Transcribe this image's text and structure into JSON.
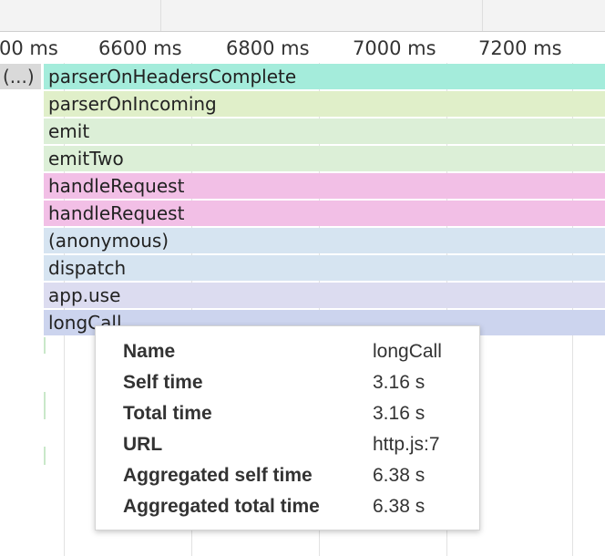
{
  "ruler": {
    "ticks": [
      "00 ms",
      "6600 ms",
      "6800 ms",
      "7000 ms",
      "7200 ms"
    ]
  },
  "flame": {
    "left_label": "(...)",
    "frames": [
      {
        "name": "parserOnHeadersComplete",
        "color": "#a4ecdb"
      },
      {
        "name": "parserOnIncoming",
        "color": "#e0efc9"
      },
      {
        "name": "emit",
        "color": "#dcefd7"
      },
      {
        "name": "emitTwo",
        "color": "#dcefd7"
      },
      {
        "name": "handleRequest",
        "color": "#f2bfe6"
      },
      {
        "name": "handleRequest",
        "color": "#f2bfe6"
      },
      {
        "name": "(anonymous)",
        "color": "#d6e4f1"
      },
      {
        "name": "dispatch",
        "color": "#d6e4f1"
      },
      {
        "name": "app.use",
        "color": "#dcdcf0"
      },
      {
        "name": "longCall",
        "color": "#ccd4ee"
      }
    ]
  },
  "tooltip": {
    "rows": [
      {
        "key": "Name",
        "value": "longCall"
      },
      {
        "key": "Self time",
        "value": "3.16 s"
      },
      {
        "key": "Total time",
        "value": "3.16 s"
      },
      {
        "key": "URL",
        "value": "http.js:7"
      },
      {
        "key": "Aggregated self time",
        "value": "6.38 s"
      },
      {
        "key": "Aggregated total time",
        "value": "6.38 s"
      }
    ]
  }
}
